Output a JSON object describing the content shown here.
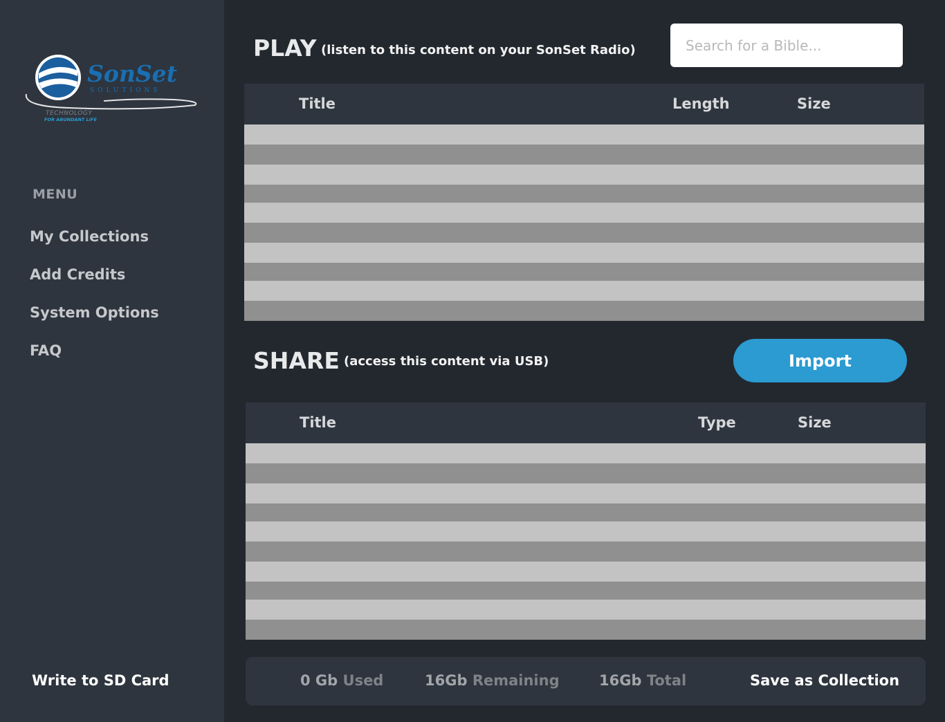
{
  "brand": {
    "name": "SonSet",
    "subname": "SOLUTIONS",
    "tagline_1": "TECHNOLOGY",
    "tagline_2": "FOR ABUNDANT LIFE",
    "color": "#1a6fb3"
  },
  "sidebar": {
    "menu_heading": "MENU",
    "items": [
      {
        "label": "My Collections"
      },
      {
        "label": "Add Credits"
      },
      {
        "label": "System Options"
      },
      {
        "label": "FAQ"
      }
    ],
    "write_sd_label": "Write to SD Card"
  },
  "play": {
    "title": "PLAY",
    "subtitle": "(listen to this content on your SonSet Radio)",
    "search_placeholder": "Search for a Bible...",
    "columns": {
      "title": "Title",
      "length": "Length",
      "size": "Size"
    }
  },
  "share": {
    "title": "SHARE",
    "subtitle": "(access this content via USB)",
    "import_label": "Import",
    "columns": {
      "title": "Title",
      "type": "Type",
      "size": "Size"
    }
  },
  "footer": {
    "used_value": "0 Gb",
    "used_label": "Used",
    "remaining_value": "16Gb",
    "remaining_label": "Remaining",
    "total_value": "16Gb",
    "total_label": "Total",
    "save_label": "Save as Collection"
  },
  "colors": {
    "accent": "#2b9bd1",
    "row_light": "#c3c3c3",
    "row_dark": "#909090"
  }
}
